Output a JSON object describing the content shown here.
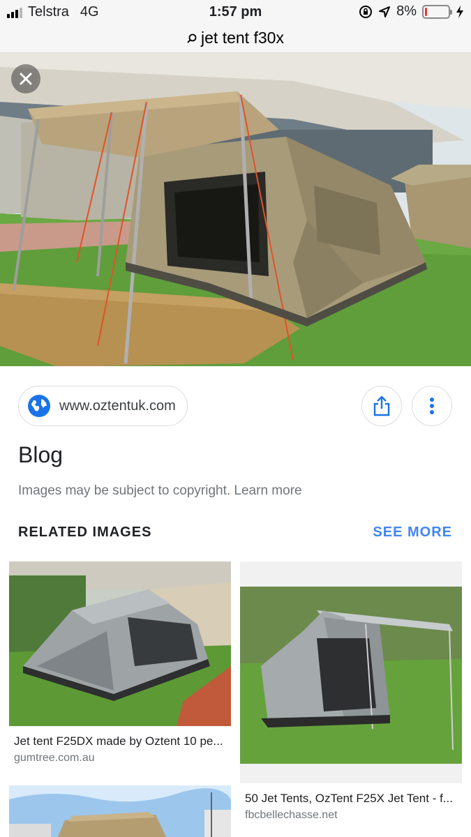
{
  "status_bar": {
    "carrier": "Telstra",
    "network": "4G",
    "time": "1:57 pm",
    "battery_percent_label": "8%",
    "battery_level": 0.08
  },
  "url_bar": {
    "search_icon": "search-icon",
    "query": "jet tent f30x"
  },
  "viewer": {
    "close_icon": "close-icon",
    "source_url": "www.oztentuk.com",
    "source_icon": "globe-icon",
    "share_icon": "share-icon",
    "more_icon": "more-vert-icon",
    "title": "Blog",
    "copyright_notice": "Images may be subject to copyright. Learn more"
  },
  "related": {
    "heading": "RELATED IMAGES",
    "see_more": "SEE MORE",
    "items": [
      {
        "title": "Jet tent F25DX made by Oztent 10 pe...",
        "site": "gumtree.com.au"
      },
      {
        "title": "50 Jet Tents, OzTent F25X Jet Tent - f...",
        "site": "fbcbellechasse.net"
      }
    ]
  },
  "colors": {
    "link_blue": "#4285f4",
    "battery_red": "#e53935",
    "grass_green": "#5f9e3a",
    "tent_khaki": "#a89b7a"
  }
}
